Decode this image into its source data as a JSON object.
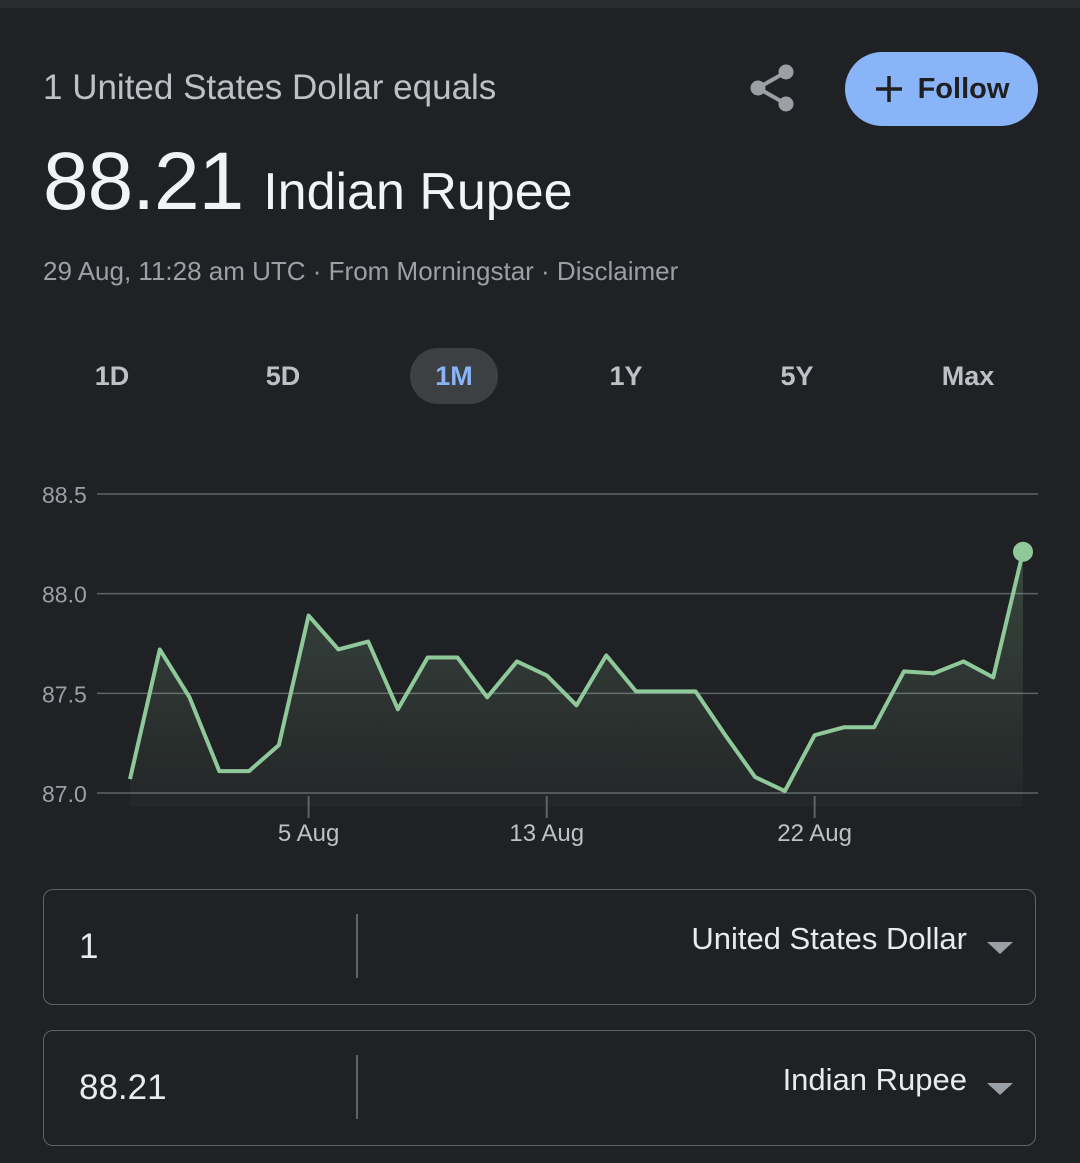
{
  "header": {
    "label": "1 United States Dollar equals",
    "follow_label": "Follow",
    "icons": {
      "share": "share-icon",
      "follow": "plus-icon"
    }
  },
  "rate": {
    "value": "88.21",
    "currency": "Indian Rupee"
  },
  "meta": "29 Aug, 11:28 am UTC · From Morningstar · Disclaimer",
  "ranges": {
    "selected": "1M",
    "items": [
      {
        "label": "1D"
      },
      {
        "label": "5D"
      },
      {
        "label": "1M"
      },
      {
        "label": "1Y"
      },
      {
        "label": "5Y"
      },
      {
        "label": "Max"
      }
    ]
  },
  "chart_data": {
    "type": "area",
    "title": "",
    "xlabel": "",
    "ylabel": "",
    "x_ticks": [
      "5 Aug",
      "13 Aug",
      "22 Aug"
    ],
    "x_tick_index": [
      6,
      14,
      23
    ],
    "y_ticks": [
      "88.5",
      "88.0",
      "87.5",
      "87.0"
    ],
    "ylim": [
      87.0,
      88.5
    ],
    "grid": true,
    "line_color": "#8fc99a",
    "values": [
      87.07,
      87.72,
      87.48,
      87.11,
      87.11,
      87.24,
      87.89,
      87.72,
      87.76,
      87.42,
      87.68,
      87.68,
      87.48,
      87.66,
      87.59,
      87.44,
      87.69,
      87.51,
      87.51,
      87.51,
      87.29,
      87.08,
      87.01,
      87.29,
      87.33,
      87.33,
      87.61,
      87.6,
      87.66,
      87.58,
      88.21
    ]
  },
  "converter": {
    "from": {
      "amount": "1",
      "currency": "United States Dollar"
    },
    "to": {
      "amount": "88.21",
      "currency": "Indian Rupee"
    }
  }
}
